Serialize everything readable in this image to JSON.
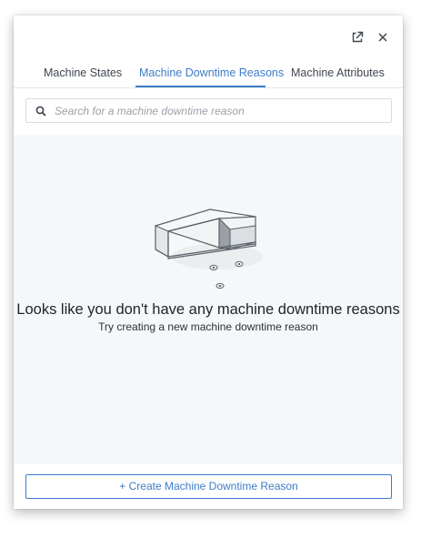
{
  "header": {
    "icons": [
      "external-link-icon",
      "close-icon"
    ]
  },
  "tabs": [
    {
      "label": "Machine States",
      "active": false
    },
    {
      "label": "Machine Downtime Reasons",
      "active": true
    },
    {
      "label": "Machine Attributes",
      "active": false
    }
  ],
  "search": {
    "placeholder": "Search for a machine downtime reason",
    "value": ""
  },
  "empty_state": {
    "title": "Looks like you don't have any machine downtime reasons",
    "subtitle": "Try creating a new machine downtime reason"
  },
  "footer": {
    "create_label": "+ Create Machine Downtime Reason"
  },
  "colors": {
    "accent": "#3d7cc9",
    "content_bg": "#f6f7f8"
  }
}
